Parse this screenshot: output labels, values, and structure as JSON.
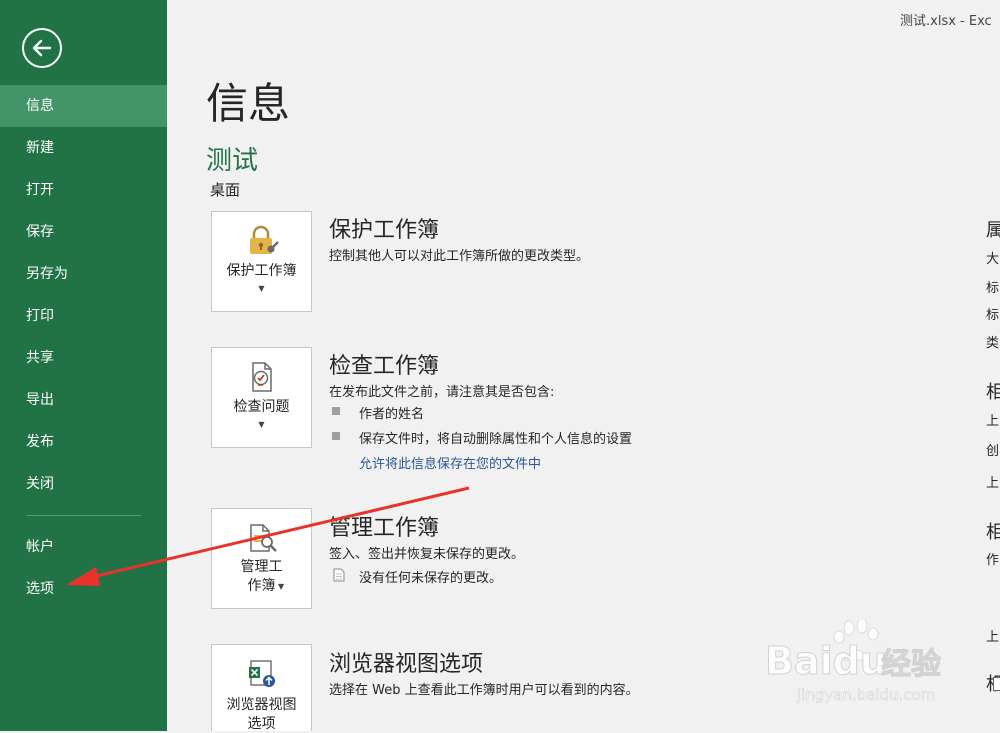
{
  "window": {
    "title": "测试.xlsx - Exc"
  },
  "sidebar": {
    "items": [
      {
        "label": "信息"
      },
      {
        "label": "新建"
      },
      {
        "label": "打开"
      },
      {
        "label": "保存"
      },
      {
        "label": "另存为"
      },
      {
        "label": "打印"
      },
      {
        "label": "共享"
      },
      {
        "label": "导出"
      },
      {
        "label": "发布"
      },
      {
        "label": "关闭"
      },
      {
        "label": "帐户"
      },
      {
        "label": "选项"
      }
    ],
    "active_index": 0
  },
  "info": {
    "title": "信息",
    "doc_name": "测试",
    "doc_path": "桌面"
  },
  "sections": {
    "protect": {
      "tile_label": "保护工作簿",
      "title": "保护工作簿",
      "desc": "控制其他人可以对此工作簿所做的更改类型。"
    },
    "inspect": {
      "tile_label": "检查问题",
      "title": "检查工作簿",
      "desc": "在发布此文件之前，请注意其是否包含:",
      "bullets": [
        "作者的姓名",
        "保存文件时，将自动删除属性和个人信息的设置"
      ],
      "link": "允许将此信息保存在您的文件中"
    },
    "manage": {
      "tile_label_1": "管理工",
      "tile_label_2": "作簿",
      "title": "管理工作簿",
      "desc": "签入、签出并恢复未保存的更改。",
      "note": "没有任何未保存的更改。"
    },
    "browser": {
      "tile_label_1": "浏览器视图",
      "tile_label_2": "选项",
      "title": "浏览器视图选项",
      "desc": "选择在 Web 上查看此工作簿时用户可以看到的内容。"
    }
  },
  "right_panel": [
    "属",
    "大",
    "标",
    "标",
    "类",
    "相",
    "上",
    "创",
    "上",
    "相",
    "作",
    "上",
    "相"
  ],
  "colors": {
    "brand": "#217346",
    "active": "#439467",
    "link": "#2b579a",
    "annotation": "#e8322a"
  },
  "watermark": {
    "brand": "Baidu",
    "suffix": "经验",
    "url": "jingyan.baidu.com"
  }
}
